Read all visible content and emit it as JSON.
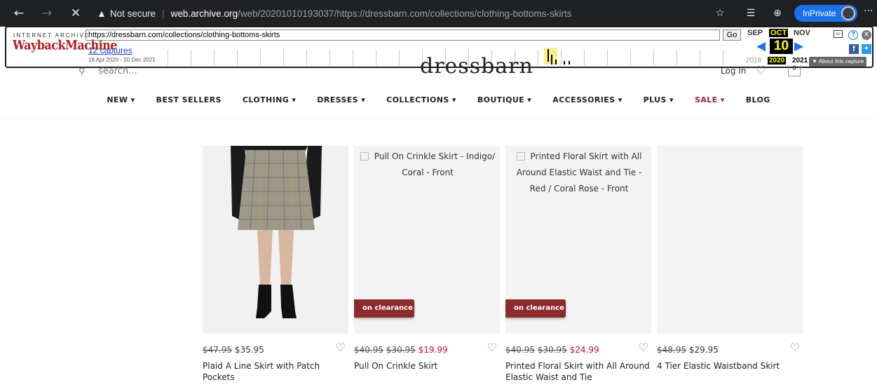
{
  "browser": {
    "security_label": "Not secure",
    "url_host": "web.archive.org",
    "url_path": "/web/20201010193037/https://dressbarn.com/collections/clothing-bottoms-skirts",
    "inprivate_label": "InPrivate",
    "more_label": "···"
  },
  "wayback": {
    "ia_label": "INTERNET ARCHIVE",
    "logo_label": "WaybackMachine",
    "url_value": "https://dressbarn.com/collections/clothing-bottoms-skirts",
    "go_label": "Go",
    "captures_label": "12 captures",
    "capture_range": "16 Apr 2020 - 20 Dec 2021",
    "prev_month": "SEP",
    "current_month": "OCT",
    "next_month": "NOV",
    "day": "10",
    "prev_year": "2019",
    "current_year": "2020",
    "next_year": "2021",
    "about_label": "▼ About this capture"
  },
  "site": {
    "search_placeholder": "search...",
    "brand": "dressbarn",
    "login_label": "Log In",
    "bag_count": "0",
    "nav": [
      {
        "label": "NEW ▾"
      },
      {
        "label": "BEST SELLERS"
      },
      {
        "label": "CLOTHING ▾"
      },
      {
        "label": "DRESSES ▾"
      },
      {
        "label": "COLLECTIONS ▾"
      },
      {
        "label": "BOUTIQUE ▾"
      },
      {
        "label": "ACCESSORIES ▾"
      },
      {
        "label": "PLUS ▾"
      },
      {
        "label": "SALE ▾"
      },
      {
        "label": "BLOG"
      }
    ]
  },
  "products": [
    {
      "name": "Plaid A Line Skirt with Patch Pockets",
      "was": "$47.95",
      "was2": "",
      "now": "$35.95",
      "alt": "",
      "badge": ""
    },
    {
      "name": "Pull On Crinkle Skirt",
      "was": "$40.95",
      "was2": "$30.95",
      "now": "$19.99",
      "alt": "Pull On Crinkle Skirt - Indigo/ Coral - Front",
      "badge": "on clearance"
    },
    {
      "name": "Printed Floral Skirt with All Around Elastic Waist and Tie",
      "was": "$40.95",
      "was2": "$30.95",
      "now": "$24.99",
      "alt": "Printed Floral Skirt with All Around Elastic Waist and Tie - Red / Coral Rose - Front",
      "badge": "on clearance"
    },
    {
      "name": "4 Tier Elastic Waistband Skirt",
      "was": "$48.95",
      "was2": "",
      "now": "$29.95",
      "alt": "",
      "badge": ""
    }
  ],
  "colors": {
    "chrome_bg": "#202124",
    "inprivate": "#1a73e8",
    "sale_red": "#c8102e",
    "badge_bg": "#8c2a2d"
  }
}
